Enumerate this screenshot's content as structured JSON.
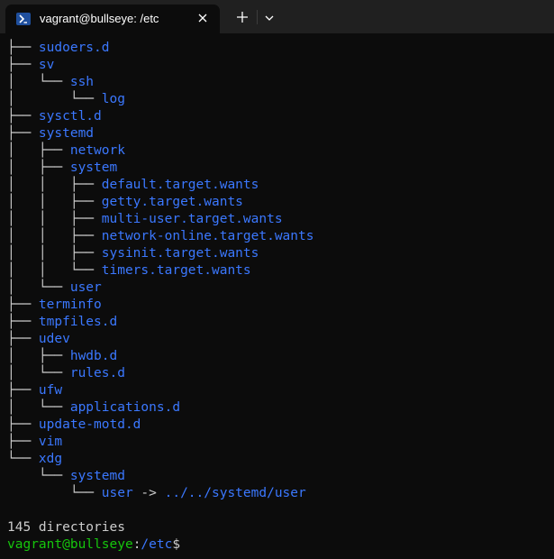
{
  "window": {
    "tab_title": "vagrant@bullseye: /etc",
    "tab_icon": "powershell-icon",
    "close_icon": "close-icon",
    "new_tab_icon": "plus-icon",
    "dropdown_icon": "chevron-down-icon"
  },
  "colors": {
    "background": "#0c0c0c",
    "directory": "#3b78ff",
    "text": "#cccccc",
    "prompt_user": "#16c60c"
  },
  "tree": [
    {
      "prefix": "├── ",
      "name": "sudoers.d"
    },
    {
      "prefix": "├── ",
      "name": "sv"
    },
    {
      "prefix": "│   └── ",
      "name": "ssh"
    },
    {
      "prefix": "│       └── ",
      "name": "log"
    },
    {
      "prefix": "├── ",
      "name": "sysctl.d"
    },
    {
      "prefix": "├── ",
      "name": "systemd"
    },
    {
      "prefix": "│   ├── ",
      "name": "network"
    },
    {
      "prefix": "│   ├── ",
      "name": "system"
    },
    {
      "prefix": "│   │   ├── ",
      "name": "default.target.wants"
    },
    {
      "prefix": "│   │   ├── ",
      "name": "getty.target.wants"
    },
    {
      "prefix": "│   │   ├── ",
      "name": "multi-user.target.wants"
    },
    {
      "prefix": "│   │   ├── ",
      "name": "network-online.target.wants"
    },
    {
      "prefix": "│   │   ├── ",
      "name": "sysinit.target.wants"
    },
    {
      "prefix": "│   │   └── ",
      "name": "timers.target.wants"
    },
    {
      "prefix": "│   └── ",
      "name": "user"
    },
    {
      "prefix": "├── ",
      "name": "terminfo"
    },
    {
      "prefix": "├── ",
      "name": "tmpfiles.d"
    },
    {
      "prefix": "├── ",
      "name": "udev"
    },
    {
      "prefix": "│   ├── ",
      "name": "hwdb.d"
    },
    {
      "prefix": "│   └── ",
      "name": "rules.d"
    },
    {
      "prefix": "├── ",
      "name": "ufw"
    },
    {
      "prefix": "│   └── ",
      "name": "applications.d"
    },
    {
      "prefix": "├── ",
      "name": "update-motd.d"
    },
    {
      "prefix": "├── ",
      "name": "vim"
    },
    {
      "prefix": "└── ",
      "name": "xdg"
    },
    {
      "prefix": "    └── ",
      "name": "systemd"
    },
    {
      "prefix": "        └── ",
      "name": "user",
      "arrow": " -> ",
      "target": "../../systemd/user"
    }
  ],
  "summary": "145 directories",
  "prompt": {
    "user_host": "vagrant@bullseye",
    "colon": ":",
    "path": "/etc",
    "symbol": "$"
  }
}
